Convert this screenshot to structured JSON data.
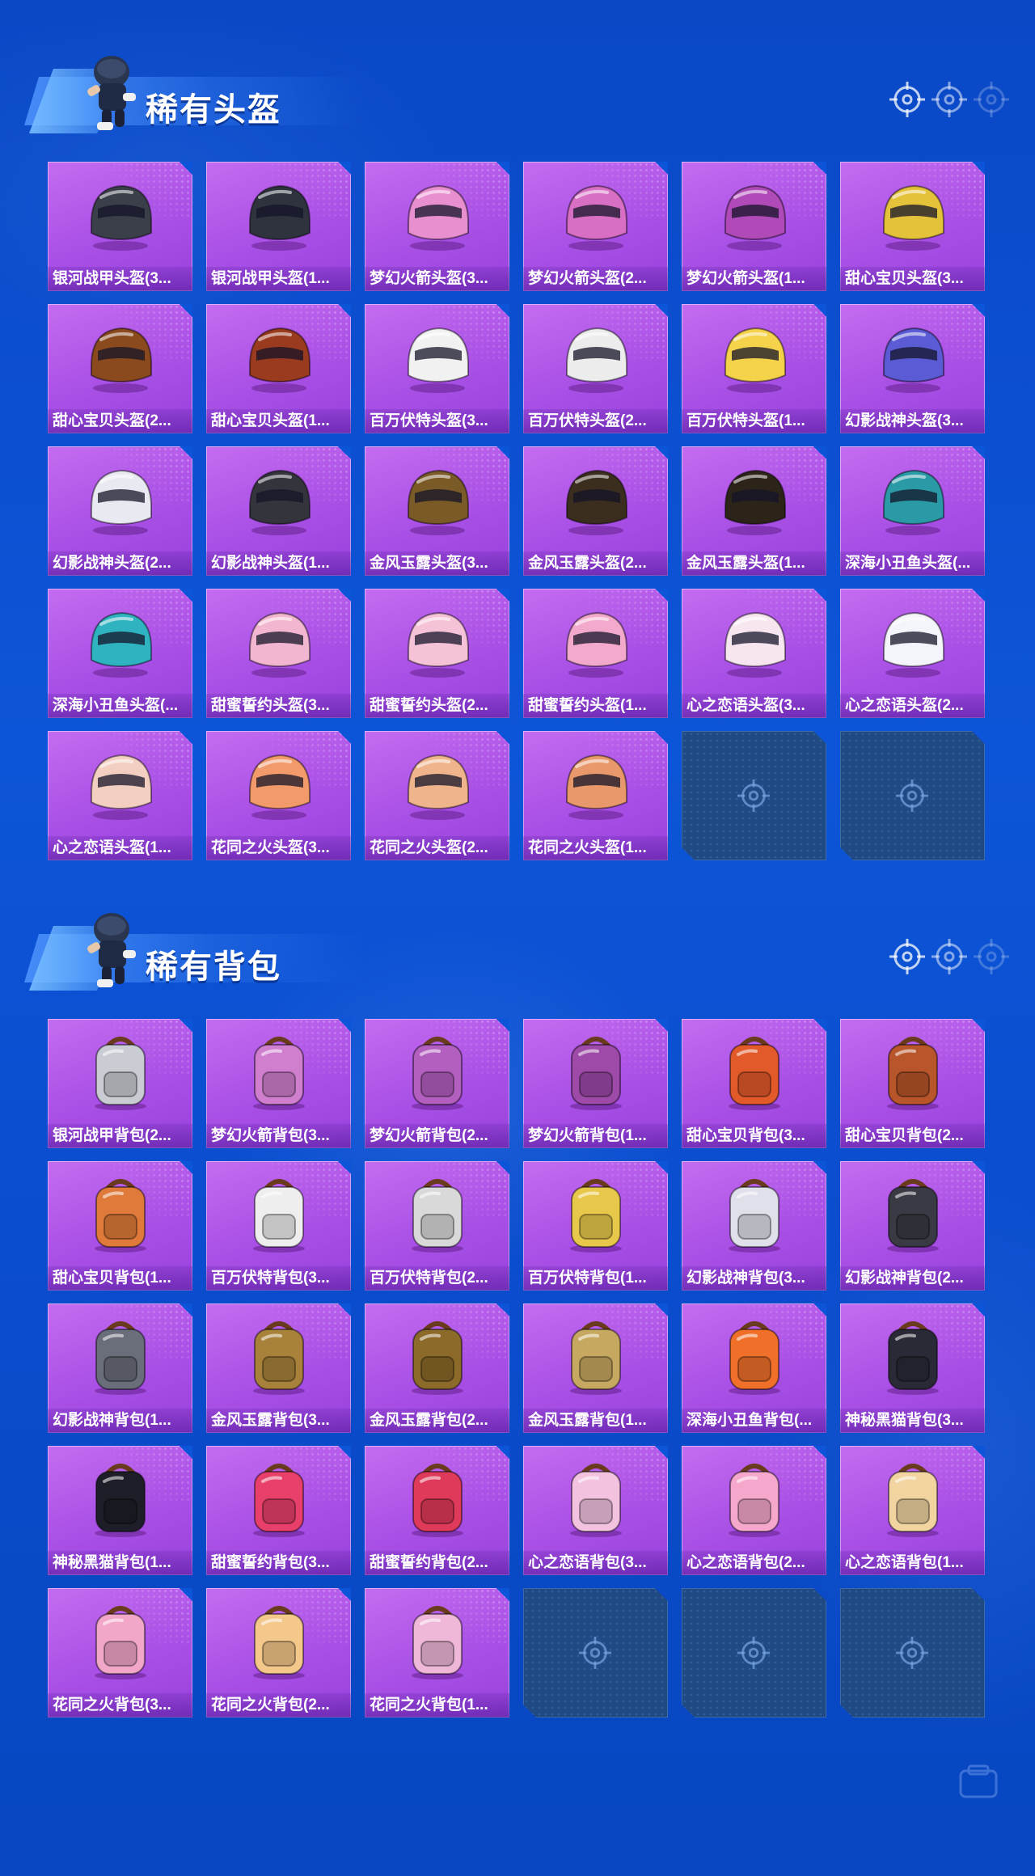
{
  "colors": {
    "background": "#0d55d8",
    "card_purple": "#b45ee9",
    "empty_slot": "#1f4a84",
    "text": "#ffffff"
  },
  "sections": {
    "helmets": {
      "title": "稀有头盔",
      "items": [
        {
          "name": "银河战甲头盔(3...",
          "hue": "#3a3f4a"
        },
        {
          "name": "银河战甲头盔(1...",
          "hue": "#2e333d"
        },
        {
          "name": "梦幻火箭头盔(3...",
          "hue": "#e88fd0"
        },
        {
          "name": "梦幻火箭头盔(2...",
          "hue": "#d86fc4"
        },
        {
          "name": "梦幻火箭头盔(1...",
          "hue": "#b04ab8"
        },
        {
          "name": "甜心宝贝头盔(3...",
          "hue": "#e4c23a"
        },
        {
          "name": "甜心宝贝头盔(2...",
          "hue": "#8a4a1e"
        },
        {
          "name": "甜心宝贝头盔(1...",
          "hue": "#9a3a1e"
        },
        {
          "name": "百万伏特头盔(3...",
          "hue": "#f1f1f1"
        },
        {
          "name": "百万伏特头盔(2...",
          "hue": "#ececec"
        },
        {
          "name": "百万伏特头盔(1...",
          "hue": "#f4d24a"
        },
        {
          "name": "幻影战神头盔(3...",
          "hue": "#5b5bd6"
        },
        {
          "name": "幻影战神头盔(2...",
          "hue": "#e9e9f2"
        },
        {
          "name": "幻影战神头盔(1...",
          "hue": "#34343c"
        },
        {
          "name": "金风玉露头盔(3...",
          "hue": "#7a5a26"
        },
        {
          "name": "金风玉露头盔(2...",
          "hue": "#3b2e1e"
        },
        {
          "name": "金风玉露头盔(1...",
          "hue": "#2c2418"
        },
        {
          "name": "深海小丑鱼头盔(...",
          "hue": "#2a9aa6"
        },
        {
          "name": "深海小丑鱼头盔(...",
          "hue": "#2fb3c0"
        },
        {
          "name": "甜蜜誓约头盔(3...",
          "hue": "#f3b6d0"
        },
        {
          "name": "甜蜜誓约头盔(2...",
          "hue": "#f6c2d8"
        },
        {
          "name": "甜蜜誓约头盔(1...",
          "hue": "#f2a9cb"
        },
        {
          "name": "心之恋语头盔(3...",
          "hue": "#f7e6f0"
        },
        {
          "name": "心之恋语头盔(2...",
          "hue": "#f4f4fb"
        },
        {
          "name": "心之恋语头盔(1...",
          "hue": "#f3cfc2"
        },
        {
          "name": "花同之火头盔(3...",
          "hue": "#f29a6a"
        },
        {
          "name": "花同之火头盔(2...",
          "hue": "#f0b48c"
        },
        {
          "name": "花同之火头盔(1...",
          "hue": "#e8986a"
        }
      ],
      "empty_slots": 2
    },
    "backpacks": {
      "title": "稀有背包",
      "items": [
        {
          "name": "银河战甲背包(2...",
          "hue": "#c9ccd2"
        },
        {
          "name": "梦幻火箭背包(3...",
          "hue": "#d07fce"
        },
        {
          "name": "梦幻火箭背包(2...",
          "hue": "#b35fbf"
        },
        {
          "name": "梦幻火箭背包(1...",
          "hue": "#9d4aa9"
        },
        {
          "name": "甜心宝贝背包(3...",
          "hue": "#e25a2a"
        },
        {
          "name": "甜心宝贝背包(2...",
          "hue": "#b8552a"
        },
        {
          "name": "甜心宝贝背包(1...",
          "hue": "#e07a3a"
        },
        {
          "name": "百万伏特背包(3...",
          "hue": "#eeeeee"
        },
        {
          "name": "百万伏特背包(2...",
          "hue": "#d9d9d9"
        },
        {
          "name": "百万伏特背包(1...",
          "hue": "#e8c84a"
        },
        {
          "name": "幻影战神背包(3...",
          "hue": "#dfe0ea"
        },
        {
          "name": "幻影战神背包(2...",
          "hue": "#3a3a44"
        },
        {
          "name": "幻影战神背包(1...",
          "hue": "#6a6d7a"
        },
        {
          "name": "金风玉露背包(3...",
          "hue": "#a8823a"
        },
        {
          "name": "金风玉露背包(2...",
          "hue": "#8c6a2a"
        },
        {
          "name": "金风玉露背包(1...",
          "hue": "#c7a860"
        },
        {
          "name": "深海小丑鱼背包(...",
          "hue": "#f0702a"
        },
        {
          "name": "神秘黑猫背包(3...",
          "hue": "#2a2a36"
        },
        {
          "name": "神秘黑猫背包(1...",
          "hue": "#1e1e28"
        },
        {
          "name": "甜蜜誓约背包(3...",
          "hue": "#e8406a"
        },
        {
          "name": "甜蜜誓约背包(2...",
          "hue": "#e03a5a"
        },
        {
          "name": "心之恋语背包(3...",
          "hue": "#f3c2de"
        },
        {
          "name": "心之恋语背包(2...",
          "hue": "#f5a8cc"
        },
        {
          "name": "心之恋语背包(1...",
          "hue": "#f1d4a0"
        },
        {
          "name": "花同之火背包(3...",
          "hue": "#f2a6c8"
        },
        {
          "name": "花同之火背包(2...",
          "hue": "#f4c78a"
        },
        {
          "name": "花同之火背包(1...",
          "hue": "#f0b8d8"
        }
      ],
      "empty_slots": 3
    }
  }
}
